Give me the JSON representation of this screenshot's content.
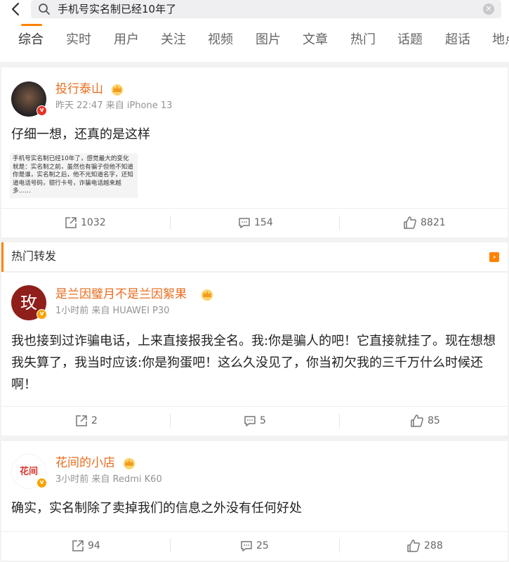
{
  "search": {
    "query": "手机号实名制已经10年了"
  },
  "tabs": [
    "综合",
    "实时",
    "用户",
    "关注",
    "视频",
    "图片",
    "文章",
    "热门",
    "话题",
    "超话",
    "地点"
  ],
  "hot_section": {
    "title": "热门转发"
  },
  "posts": [
    {
      "username": "投行泰山",
      "meta": "昨天 22:47 来自 iPhone 13",
      "text": "仔细一想，还真的是这样",
      "image_text": "手机号实名制已经10年了，感觉最大的变化就是：实名制之前，虽然也有骗子但他不知道你是谁，实名制之后，他不光知道名字，还知道电话号码，银行卡号，诈骗电话越来越多……",
      "reposts": "1032",
      "comments": "154",
      "likes": "8821"
    },
    {
      "username": "是兰因璧月不是兰因絮果",
      "avatar_text": "玫",
      "meta": "1小时前 来自 HUAWEI P30",
      "text": "我也接到过诈骗电话，上来直接报我全名。我:你是骗人的吧！它直接就挂了。现在想想我失算了，我当时应该:你是狗蛋吧！这么久没见了，你当初欠我的三千万什么时候还啊！",
      "reposts": "2",
      "comments": "5",
      "likes": "85"
    },
    {
      "username": "花间的小店",
      "avatar_text": "花间",
      "meta": "3小时前 来自 Redmi K60",
      "text": "确实，实名制除了卖掉我们的信息之外没有任何好处",
      "reposts": "94",
      "comments": "25",
      "likes": "288"
    }
  ],
  "colors": {
    "accent": "#ff8200",
    "username": "#e86d1f"
  }
}
